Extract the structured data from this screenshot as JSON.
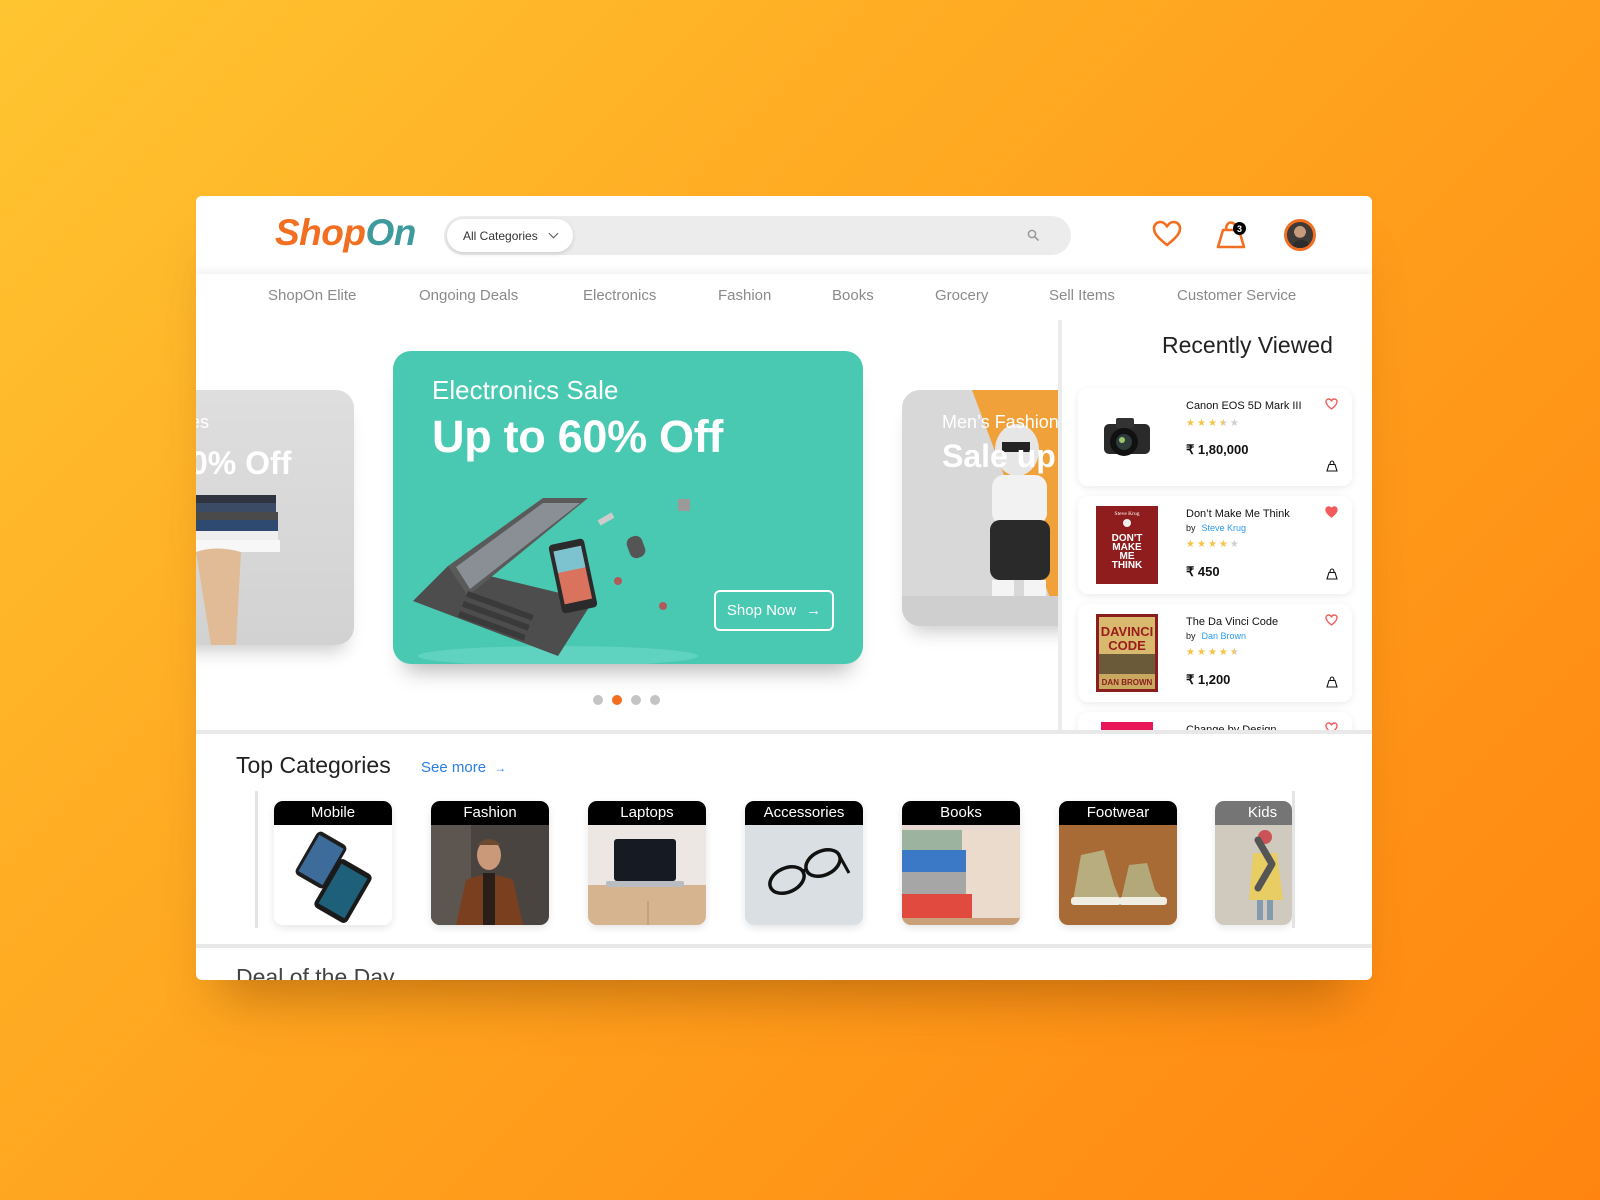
{
  "brand": {
    "part1": "Shop",
    "part2": "On"
  },
  "search": {
    "category": "All Categories",
    "placeholder": ""
  },
  "header": {
    "cart_count": "3"
  },
  "nav": {
    "items": [
      "ShopOn Elite",
      "Ongoing Deals",
      "Electronics",
      "Fashion",
      "Books",
      "Grocery",
      "Sell Items",
      "Customer Service"
    ]
  },
  "carousel": {
    "left": {
      "kicker": "es",
      "headline": "0% Off"
    },
    "main": {
      "kicker": "Electronics Sale",
      "headline": "Up to 60% Off",
      "cta": "Shop Now",
      "cta_icon": "→"
    },
    "right": {
      "kicker": "Men’s Fashion",
      "headline": "Sale up"
    },
    "slide_count": 4,
    "active_index": 1
  },
  "recently_viewed": {
    "title": "Recently Viewed",
    "items": [
      {
        "name": "Canon EOS 5D Mark III",
        "author": "",
        "rating": 3.5,
        "price": "₹ 1,80,000",
        "favorited": false
      },
      {
        "name": "Don’t Make Me Think",
        "author_prefix": "by",
        "author": "Steve Krug",
        "rating": 4,
        "price": "₹ 450",
        "favorited": true
      },
      {
        "name": "The Da Vinci Code",
        "author_prefix": "by",
        "author": "Dan Brown",
        "rating": 4.5,
        "price": "₹ 1,200",
        "favorited": false
      },
      {
        "name": "Change by Design",
        "author": "",
        "rating": null,
        "price": "",
        "favorited": false
      }
    ]
  },
  "top_categories": {
    "title": "Top Categories",
    "see_more": "See more",
    "see_more_icon": "→",
    "items": [
      "Mobile",
      "Fashion",
      "Laptops",
      "Accessories",
      "Books",
      "Footwear",
      "Kids"
    ]
  },
  "deal_of_day": {
    "title": "Deal of the Day"
  },
  "colors": {
    "brand_orange": "#f26e21",
    "brand_teal": "#3e9a9d",
    "hero_teal": "#49c8b2",
    "link_blue": "#2a7de1",
    "heart_red": "#f25c5c",
    "star_gold": "#f6c344"
  }
}
